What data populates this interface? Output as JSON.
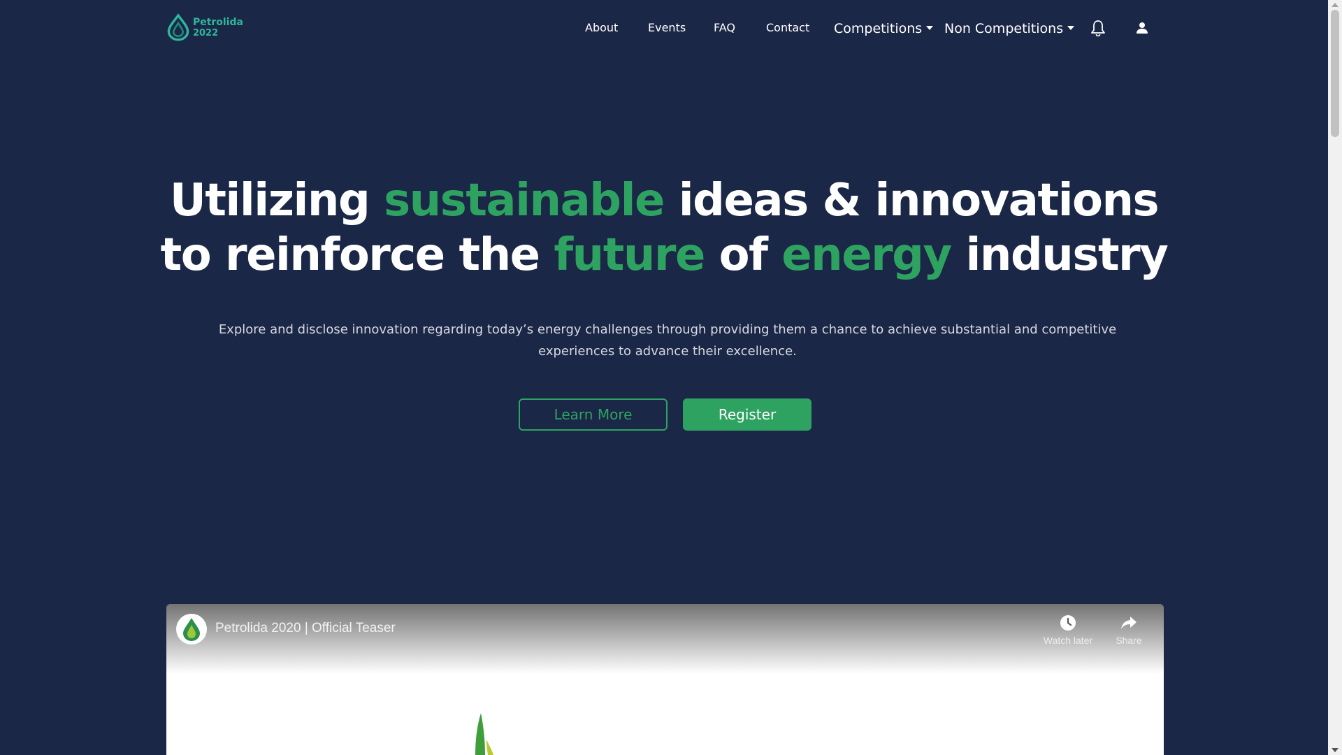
{
  "nav": {
    "logo": {
      "line1": "Petrolida",
      "line2": "2022"
    },
    "links": [
      "About",
      "Events",
      "FAQ",
      "Contact"
    ],
    "competitions": "Competitions",
    "non_competitions": "Non Competitions",
    "icons": {
      "bell": "bell-icon",
      "user": "user-icon"
    }
  },
  "hero": {
    "title_line1": [
      "Utilizing ",
      "sustainable",
      " ideas & innovations"
    ],
    "title_line2": [
      "to reinforce the ",
      "future",
      " of ",
      "energy",
      " industry"
    ],
    "subtitle_line1": "Explore and disclose innovation regarding today’s energy challenges through providing them a chance to achieve substantial and competitive",
    "subtitle_line2": "experiences to advance their excellence.",
    "learn_more": "Learn More",
    "register": "Register"
  },
  "video": {
    "title": "Petrolida 2020 | Official Teaser",
    "watch_later": "Watch later",
    "share": "Share"
  },
  "colors": {
    "background": "#1b2746",
    "accent": "#2ea361",
    "logo": "#2fb59b"
  }
}
